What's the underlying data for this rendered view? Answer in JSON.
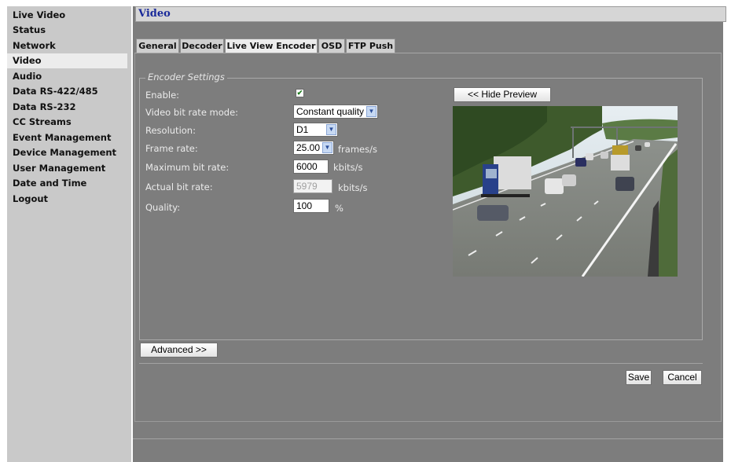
{
  "sidebar": {
    "items": [
      {
        "label": "Live Video",
        "active": false
      },
      {
        "label": "Status",
        "active": false
      },
      {
        "label": "Network",
        "active": false
      },
      {
        "label": "Video",
        "active": true
      },
      {
        "label": "Audio",
        "active": false
      },
      {
        "label": "Data RS-422/485",
        "active": false
      },
      {
        "label": "Data RS-232",
        "active": false
      },
      {
        "label": "CC Streams",
        "active": false
      },
      {
        "label": "Event Management",
        "active": false
      },
      {
        "label": "Device Management",
        "active": false
      },
      {
        "label": "User Management",
        "active": false
      },
      {
        "label": "Date and Time",
        "active": false
      },
      {
        "label": "Logout",
        "active": false
      }
    ]
  },
  "page": {
    "title": "Video"
  },
  "tabs": [
    {
      "label": "General",
      "active": false
    },
    {
      "label": "Decoder",
      "active": false
    },
    {
      "label": "Live View Encoder",
      "active": true
    },
    {
      "label": "OSD",
      "active": false
    },
    {
      "label": "FTP Push",
      "active": false
    }
  ],
  "encoder": {
    "legend": "Encoder Settings",
    "enable_label": "Enable:",
    "enable_checked": true,
    "bitrate_mode_label": "Video bit rate mode:",
    "bitrate_mode_value": "Constant quality",
    "resolution_label": "Resolution:",
    "resolution_value": "D1",
    "frame_rate_label": "Frame rate:",
    "frame_rate_value": "25.00",
    "frame_rate_unit": "frames/s",
    "max_bitrate_label": "Maximum bit rate:",
    "max_bitrate_value": "6000",
    "max_bitrate_unit": "kbits/s",
    "actual_bitrate_label": "Actual bit rate:",
    "actual_bitrate_value": "5979",
    "actual_bitrate_unit": "kbits/s",
    "quality_label": "Quality:",
    "quality_value": "100",
    "quality_unit": "%"
  },
  "buttons": {
    "hide_preview": "<< Hide Preview",
    "advanced": "Advanced >>",
    "save": "Save",
    "cancel": "Cancel"
  },
  "icons": {
    "select_arrow": "chevron-down-icon",
    "check": "check-icon"
  }
}
